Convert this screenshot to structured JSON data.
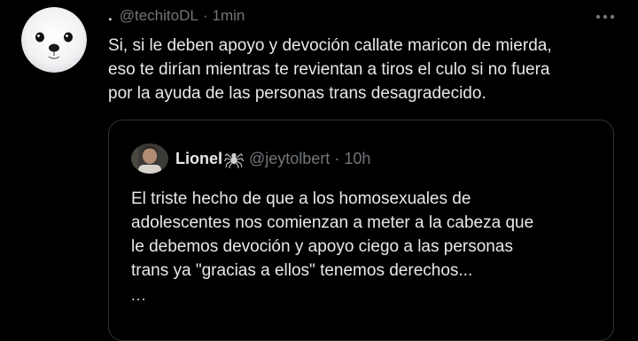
{
  "tweet": {
    "display_name": ".",
    "handle": "@techitoDL",
    "separator": "·",
    "time": "1min",
    "text": "Si, si le deben apoyo y devoción callate maricon de mierda,\neso te dirían mientras te revientan a tiros el culo si no fuera\npor la ayuda de las personas trans desagradecido.",
    "avatar_icon": "seal-avatar",
    "more_icon": "more-horizontal-icon"
  },
  "quote": {
    "display_name": "Lionel",
    "name_emoji_icon": "spider-icon",
    "handle": "@jeytolbert",
    "separator": "·",
    "time": "10h",
    "text": "El triste hecho de que a los homosexuales de\nadolescentes nos comienzan a meter a la cabeza que\nle debemos devoción y apoyo ciego a las personas\ntrans ya \"gracias a ellos\" tenemos derechos...",
    "ellipsis": "...",
    "avatar_icon": "user-photo-avatar"
  },
  "colors": {
    "background": "#000000",
    "text_primary": "#e7e9ea",
    "text_muted": "#71767b",
    "border": "#2f3336"
  }
}
